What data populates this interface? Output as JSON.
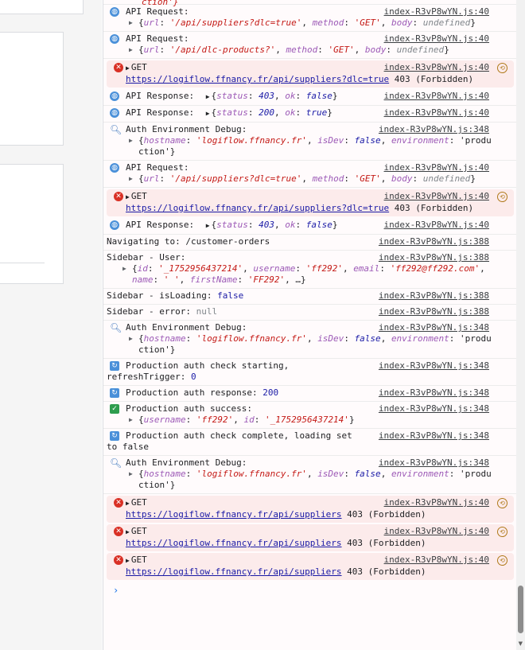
{
  "console": {
    "top_partial": "ction'}",
    "source_file": "index-R3vP8wYN.js",
    "entries": [
      {
        "type": "log",
        "icon": "globe",
        "text": "API Request:",
        "src": "index-R3vP8wYN.js:40",
        "obj": [
          [
            "url",
            "'/api/suppliers?dlc=true'"
          ],
          [
            "method",
            "'GET'"
          ],
          [
            "body",
            "undefined"
          ]
        ]
      },
      {
        "type": "log",
        "icon": "globe",
        "text": "API Request:",
        "src": "index-R3vP8wYN.js:40",
        "obj": [
          [
            "url",
            "'/api/dlc-products?'"
          ],
          [
            "method",
            "'GET'"
          ],
          [
            "body",
            "undefined"
          ]
        ]
      },
      {
        "type": "error",
        "method": "GET",
        "url": "https://logiflow.ffnancy.fr/api/suppliers?dlc=true",
        "status": "403 (Forbidden)",
        "src": "index-R3vP8wYN.js:40"
      },
      {
        "type": "log",
        "icon": "globe",
        "text": "API Response:",
        "src": "index-R3vP8wYN.js:40",
        "inline": [
          [
            "status",
            "403"
          ],
          [
            "ok",
            "false"
          ]
        ]
      },
      {
        "type": "log",
        "icon": "globe",
        "text": "API Response:",
        "src": "index-R3vP8wYN.js:40",
        "inline": [
          [
            "status",
            "200"
          ],
          [
            "ok",
            "true"
          ]
        ]
      },
      {
        "type": "log",
        "icon": "search",
        "text": "Auth Environment Debug:",
        "src": "index-R3vP8wYN.js:348",
        "obj_line1": "{hostname: 'logiflow.ffnancy.fr', isDev: false, environment: 'produ",
        "obj_line2": "ction'}"
      },
      {
        "type": "log",
        "icon": "globe",
        "text": "API Request:",
        "src": "index-R3vP8wYN.js:40",
        "obj": [
          [
            "url",
            "'/api/suppliers?dlc=true'"
          ],
          [
            "method",
            "'GET'"
          ],
          [
            "body",
            "undefined"
          ]
        ]
      },
      {
        "type": "error",
        "method": "GET",
        "url": "https://logiflow.ffnancy.fr/api/suppliers?dlc=true",
        "status": "403 (Forbidden)",
        "src": "index-R3vP8wYN.js:40"
      },
      {
        "type": "log",
        "icon": "globe",
        "text": "API Response:",
        "src": "index-R3vP8wYN.js:40",
        "inline": [
          [
            "status",
            "403"
          ],
          [
            "ok",
            "false"
          ]
        ]
      },
      {
        "type": "plain",
        "text": "Navigating to: /customer-orders",
        "src": "index-R3vP8wYN.js:388"
      },
      {
        "type": "plain",
        "text": "Sidebar - User:",
        "src": "index-R3vP8wYN.js:388",
        "obj_line1": "{id: '_1752956437214', username: 'ff292', email: 'ff292@ff292.com',",
        "obj_line2": "name: ' ', firstName: 'FF292', …}"
      },
      {
        "type": "plain",
        "text": "Sidebar - isLoading:",
        "value": "false",
        "src": "index-R3vP8wYN.js:388"
      },
      {
        "type": "plain",
        "text": "Sidebar - error:",
        "value": "null",
        "src": "index-R3vP8wYN.js:388"
      },
      {
        "type": "log",
        "icon": "search",
        "text": "Auth Environment Debug:",
        "src": "index-R3vP8wYN.js:348",
        "obj_line1": "{hostname: 'logiflow.ffnancy.fr', isDev: false, environment: 'produ",
        "obj_line2": "ction'}"
      },
      {
        "type": "log",
        "icon": "sync",
        "text": "Production auth check starting,",
        "text2": "refreshTrigger:",
        "value": "0",
        "src": "index-R3vP8wYN.js:348"
      },
      {
        "type": "log",
        "icon": "sync",
        "text": "Production auth response:",
        "value": "200",
        "src": "index-R3vP8wYN.js:348"
      },
      {
        "type": "log",
        "icon": "check",
        "text": "Production auth success:",
        "src": "index-R3vP8wYN.js:348",
        "obj_line1": "{username: 'ff292', id: '_1752956437214'}"
      },
      {
        "type": "log",
        "icon": "sync",
        "text": "Production auth check complete, loading set",
        "text2": "to false",
        "src": "index-R3vP8wYN.js:348"
      },
      {
        "type": "log",
        "icon": "search",
        "text": "Auth Environment Debug:",
        "src": "index-R3vP8wYN.js:348",
        "obj_line1": "{hostname: 'logiflow.ffnancy.fr', isDev: false, environment: 'produ",
        "obj_line2": "ction'}"
      },
      {
        "type": "error",
        "method": "GET",
        "url": "https://logiflow.ffnancy.fr/api/suppliers",
        "status": "403 (Forbidden)",
        "src": "index-R3vP8wYN.js:40"
      },
      {
        "type": "error",
        "method": "GET",
        "url": "https://logiflow.ffnancy.fr/api/suppliers",
        "status": "403 (Forbidden)",
        "src": "index-R3vP8wYN.js:40"
      },
      {
        "type": "error",
        "method": "GET",
        "url": "https://logiflow.ffnancy.fr/api/suppliers",
        "status": "403 (Forbidden)",
        "src": "index-R3vP8wYN.js:40"
      }
    ],
    "prompt_symbol": "›"
  },
  "colors": {
    "error_bg": "#fcebeb",
    "error_icon": "#d93025",
    "key": "#9c59b6",
    "string": "#c41a16",
    "keyword": "#1a1aa6"
  }
}
